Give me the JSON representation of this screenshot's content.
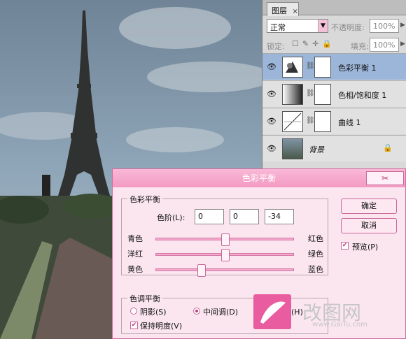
{
  "layers_panel": {
    "tab_label": "图层",
    "tab_close": "×",
    "blend_mode": "正常",
    "opacity_label": "不透明度:",
    "opacity_value": "100%",
    "lock_label": "锁定:",
    "fill_label": "填充:",
    "fill_value": "100%",
    "layers": [
      {
        "name": "色彩平衡 1",
        "selected": true
      },
      {
        "name": "色相/饱和度 1",
        "selected": false
      },
      {
        "name": "曲线 1",
        "selected": false
      },
      {
        "name": "背景",
        "selected": false
      }
    ]
  },
  "dialog": {
    "title": "色彩平衡",
    "color_balance_group": "色彩平衡",
    "levels_label": "色阶(L):",
    "levels": [
      "0",
      "0",
      "-34"
    ],
    "sliders": [
      {
        "left": "青色",
        "right": "红色",
        "value": 0
      },
      {
        "left": "洋红",
        "right": "绿色",
        "value": 0
      },
      {
        "left": "黄色",
        "right": "蓝色",
        "value": -34
      }
    ],
    "ok_label": "确定",
    "cancel_label": "取消",
    "preview_label": "预览(P)",
    "tone_group": "色调平衡",
    "shadows_label": "阴影(S)",
    "midtones_label": "中间调(D)",
    "highlights_label": "高光(H)",
    "preserve_label": "保持明度(V)"
  },
  "watermark": {
    "text": "改图网",
    "url": "www.GaiTu.com"
  }
}
